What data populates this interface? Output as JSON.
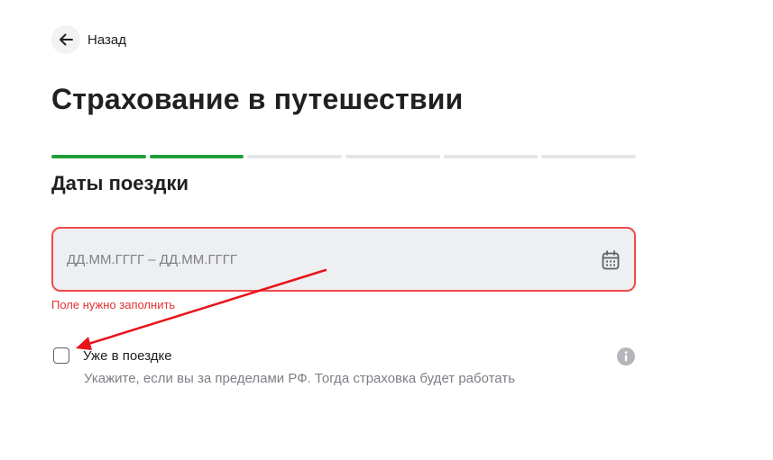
{
  "header": {
    "back_label": "Назад",
    "title": "Страхование в путешествии"
  },
  "progress": {
    "total_steps": 6,
    "completed_steps": 2,
    "accent_color": "#21a038"
  },
  "step": {
    "title": "Даты поездки",
    "date_field": {
      "placeholder": "ДД.ММ.ГГГГ – ДД.ММ.ГГГГ",
      "value": "",
      "error_text": "Поле нужно заполнить",
      "error_color": "#ef4b4b"
    },
    "already_travelling": {
      "label": "Уже в поездке",
      "checked": false,
      "hint": "Укажите, если вы за пределами РФ. Тогда страховка будет работать"
    }
  },
  "icons": {
    "back": "arrow-left-icon",
    "calendar": "calendar-icon",
    "info": "info-icon"
  },
  "annotation": {
    "color": "#e8131b"
  }
}
